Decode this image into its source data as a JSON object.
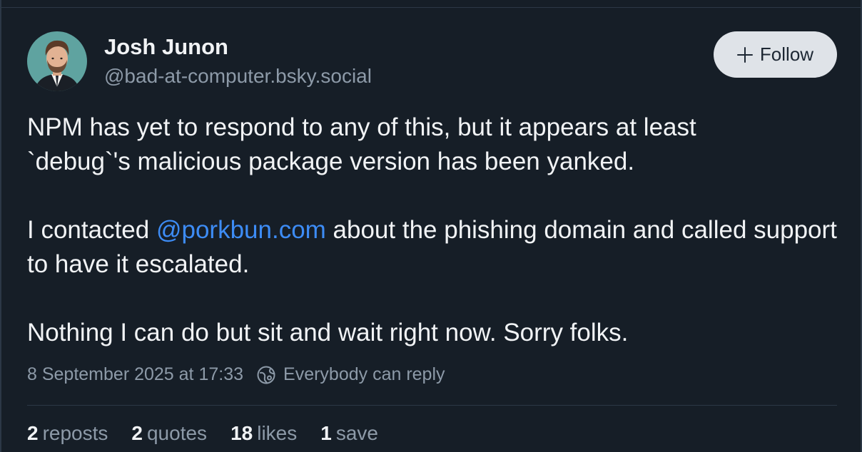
{
  "author": {
    "display_name": "Josh Junon",
    "handle": "@bad-at-computer.bsky.social"
  },
  "follow_button": {
    "label": "Follow",
    "icon": "plus-icon"
  },
  "post": {
    "paragraph_1_line_1": "NPM has yet to respond to any of this, but it appears at least",
    "paragraph_1_line_2": "`debug`'s malicious package version has been yanked.",
    "paragraph_2_before_mention": "I contacted ",
    "paragraph_2_mention": "@porkbun.com",
    "paragraph_2_after_mention": " about the phishing domain and called support to have it escalated.",
    "paragraph_3": "Nothing I can do but sit and wait right now. Sorry folks."
  },
  "meta": {
    "timestamp": "8 September 2025 at 17:33",
    "reply_icon": "globe-icon",
    "reply_setting": "Everybody can reply"
  },
  "stats": {
    "reposts": {
      "count": "2",
      "label": "reposts"
    },
    "quotes": {
      "count": "2",
      "label": "quotes"
    },
    "likes": {
      "count": "18",
      "label": "likes"
    },
    "saves": {
      "count": "1",
      "label": "save"
    }
  },
  "colors": {
    "background": "#161e27",
    "text_primary": "#f1f3f5",
    "text_secondary": "#8d9aa8",
    "mention_link": "#3d8cf5",
    "follow_button_bg": "#dfe3e8",
    "divider": "#2c3846"
  }
}
